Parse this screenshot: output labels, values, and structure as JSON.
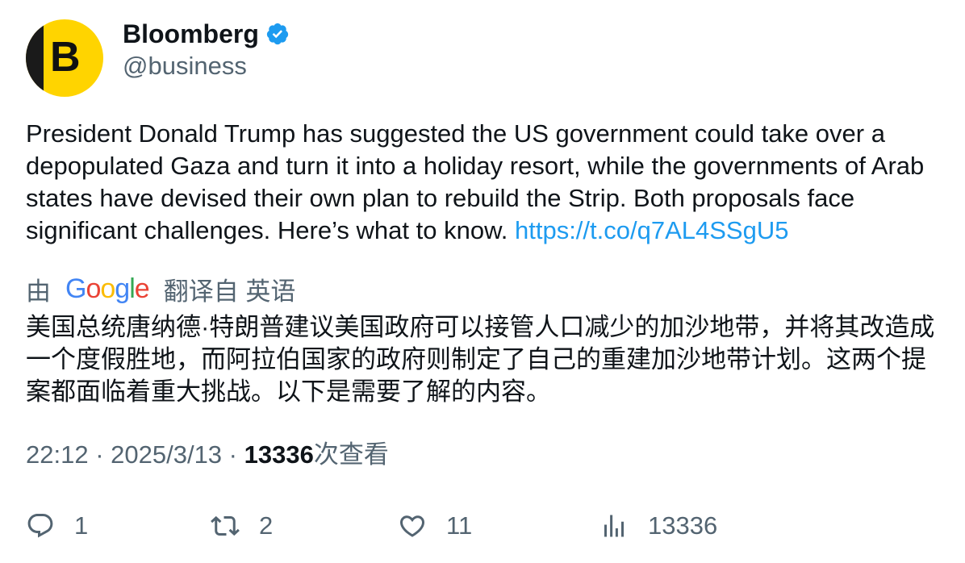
{
  "account": {
    "name": "Bloomberg",
    "handle": "@business",
    "avatar_letter": "B",
    "verified": true,
    "avatar_color": "#ffd400"
  },
  "tweet": {
    "text": "President Donald Trump has suggested the US government could take over a depopulated Gaza and turn it into a holiday resort, while the governments of Arab states have devised their own plan to rebuild the Strip. Both proposals face significant challenges. Here’s what to know. ",
    "link": "https://t.co/q7AL4SSgU5",
    "link_color": "#1d9bf0"
  },
  "translation": {
    "prefix": "由",
    "provider": "Google",
    "suffix": "翻译自 英语",
    "text": "美国总统唐纳德·特朗普建议美国政府可以接管人口减少的加沙地带，并将其改造成一个度假胜地，而阿拉伯国家的政府则制定了自己的重建加沙地带计划。这两个提案都面临着重大挑战。以下是需要了解的内容。"
  },
  "meta": {
    "time": "22:12",
    "separator": " · ",
    "date": "2025/3/13",
    "views_count": "13336",
    "views_label": "次查看"
  },
  "actions": {
    "reply": {
      "icon": "reply-icon",
      "count": "1"
    },
    "retweet": {
      "icon": "retweet-icon",
      "count": "2"
    },
    "like": {
      "icon": "heart-icon",
      "count": "11"
    },
    "views": {
      "icon": "views-icon",
      "count": "13336"
    }
  }
}
